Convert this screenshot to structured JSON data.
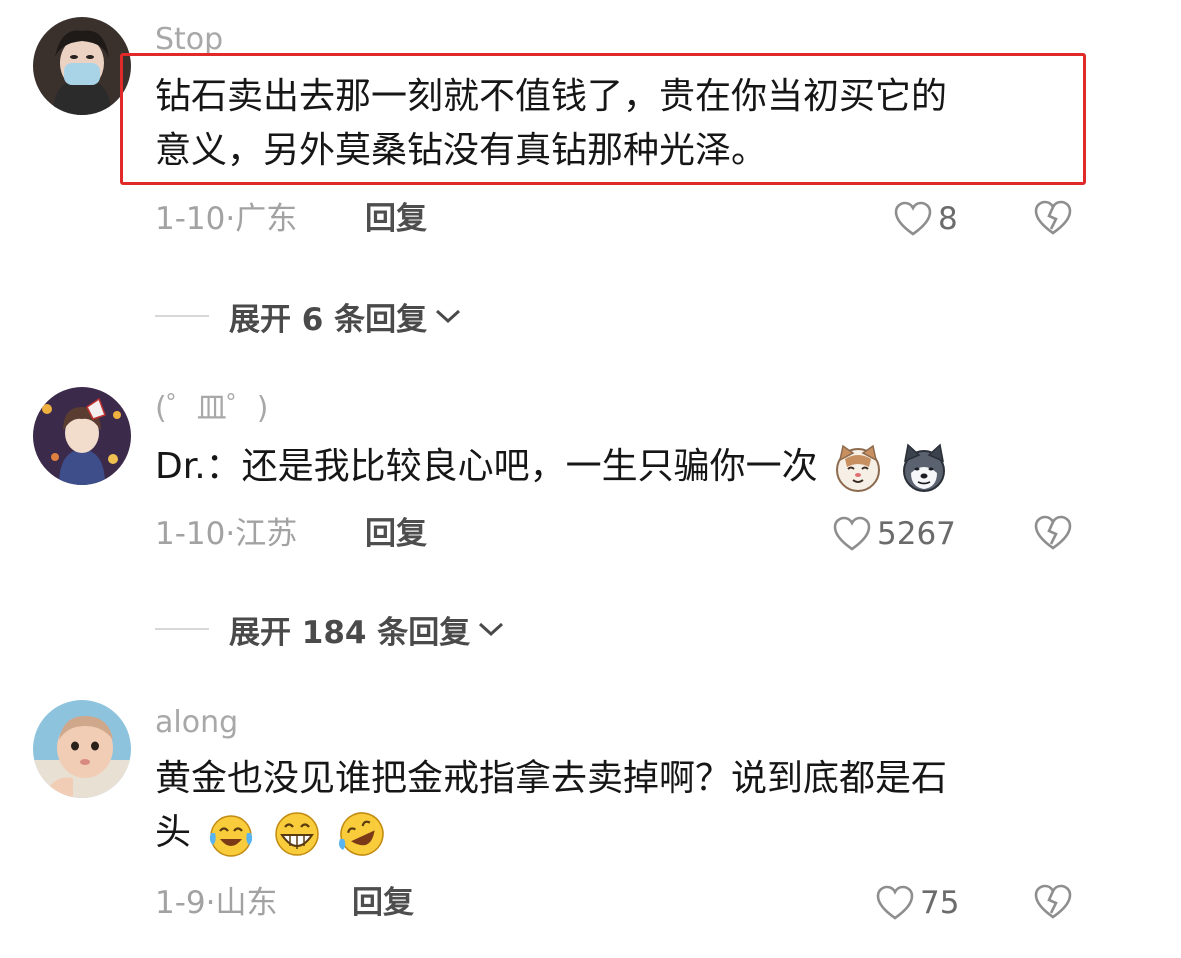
{
  "comments": [
    {
      "username": "Stop",
      "text_lines": [
        "钻石卖出去那一刻就不值钱了，贵在你当初买它的",
        "意义，另外莫桑钻没有真钻那种光泽。"
      ],
      "date": "1-10",
      "location": "广东",
      "reply_label": "回复",
      "likes": "8",
      "expand_label": "展开 6 条回复"
    },
    {
      "username": "(゜皿゜)",
      "text": "Dr.：还是我比较良心吧，一生只骗你一次",
      "emojis": [
        "cat-face-emoji",
        "husky-dog-emoji"
      ],
      "date": "1-10",
      "location": "江苏",
      "reply_label": "回复",
      "likes": "5267",
      "expand_label": "展开 184 条回复"
    },
    {
      "username": "along",
      "text_lines": [
        "黄金也没见谁把金戒指拿去卖掉啊？说到底都是石",
        "头"
      ],
      "emojis": [
        "crying-laughing-emoji",
        "grinning-teeth-emoji",
        "rolling-laughing-emoji"
      ],
      "date": "1-9",
      "location": "山东",
      "reply_label": "回复",
      "likes": "75"
    }
  ],
  "colors": {
    "highlight_border": "#e02a2a",
    "username": "#a8a8a8",
    "text": "#161616",
    "meta": "#a2a2a2"
  },
  "meta_separator": "·"
}
